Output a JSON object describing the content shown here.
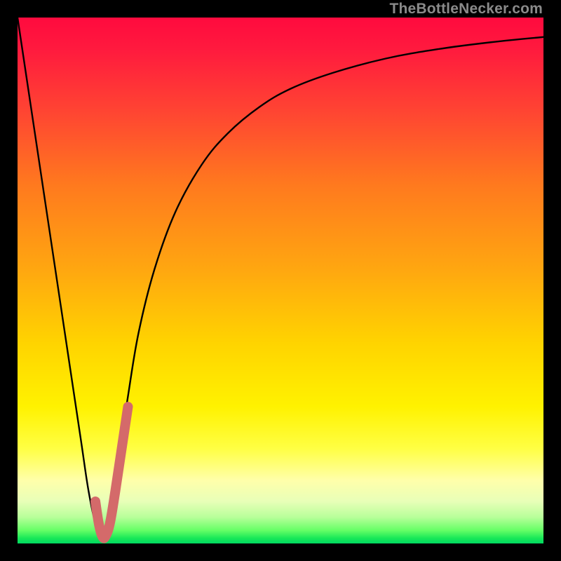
{
  "watermark": "TheBottleNecker.com",
  "chart_data": {
    "type": "line",
    "title": "",
    "xlabel": "",
    "ylabel": "",
    "xlim": [
      0,
      100
    ],
    "ylim": [
      0,
      100
    ],
    "gradient_stops": [
      {
        "pos": 0.0,
        "color": "#ff0a3e"
      },
      {
        "pos": 0.06,
        "color": "#ff1a3e"
      },
      {
        "pos": 0.18,
        "color": "#ff4532"
      },
      {
        "pos": 0.32,
        "color": "#ff7a1e"
      },
      {
        "pos": 0.48,
        "color": "#ffa710"
      },
      {
        "pos": 0.62,
        "color": "#ffd400"
      },
      {
        "pos": 0.74,
        "color": "#fff200"
      },
      {
        "pos": 0.82,
        "color": "#ffff44"
      },
      {
        "pos": 0.88,
        "color": "#ffffaa"
      },
      {
        "pos": 0.92,
        "color": "#e8ffb8"
      },
      {
        "pos": 0.95,
        "color": "#b8ff9a"
      },
      {
        "pos": 0.975,
        "color": "#66ff66"
      },
      {
        "pos": 0.99,
        "color": "#18e858"
      },
      {
        "pos": 1.0,
        "color": "#00d860"
      }
    ],
    "series": [
      {
        "name": "bottleneck-curve",
        "color": "#000000",
        "stroke_width": 2.4,
        "role": "main",
        "x": [
          0.0,
          3.0,
          6.0,
          9.0,
          12.0,
          13.5,
          15.0,
          16.0,
          17.0,
          18.0,
          19.5,
          21.0,
          23.0,
          26.0,
          30.0,
          35.0,
          40.0,
          46.0,
          52.0,
          60.0,
          70.0,
          80.0,
          90.0,
          100.0
        ],
        "y": [
          100.0,
          80.0,
          60.0,
          40.0,
          20.0,
          10.0,
          3.0,
          1.0,
          2.0,
          8.0,
          18.0,
          28.0,
          40.0,
          52.0,
          63.0,
          72.0,
          78.0,
          83.0,
          86.5,
          89.5,
          92.2,
          94.0,
          95.3,
          96.3
        ]
      },
      {
        "name": "highlight-j",
        "color": "#d46a6a",
        "stroke_width": 14,
        "linecap": "round",
        "role": "annotation",
        "x": [
          14.8,
          15.5,
          16.2,
          16.8,
          17.6,
          18.6,
          19.8,
          21.0
        ],
        "y": [
          8.0,
          3.5,
          1.2,
          1.5,
          4.0,
          10.0,
          18.0,
          26.0
        ]
      }
    ]
  }
}
